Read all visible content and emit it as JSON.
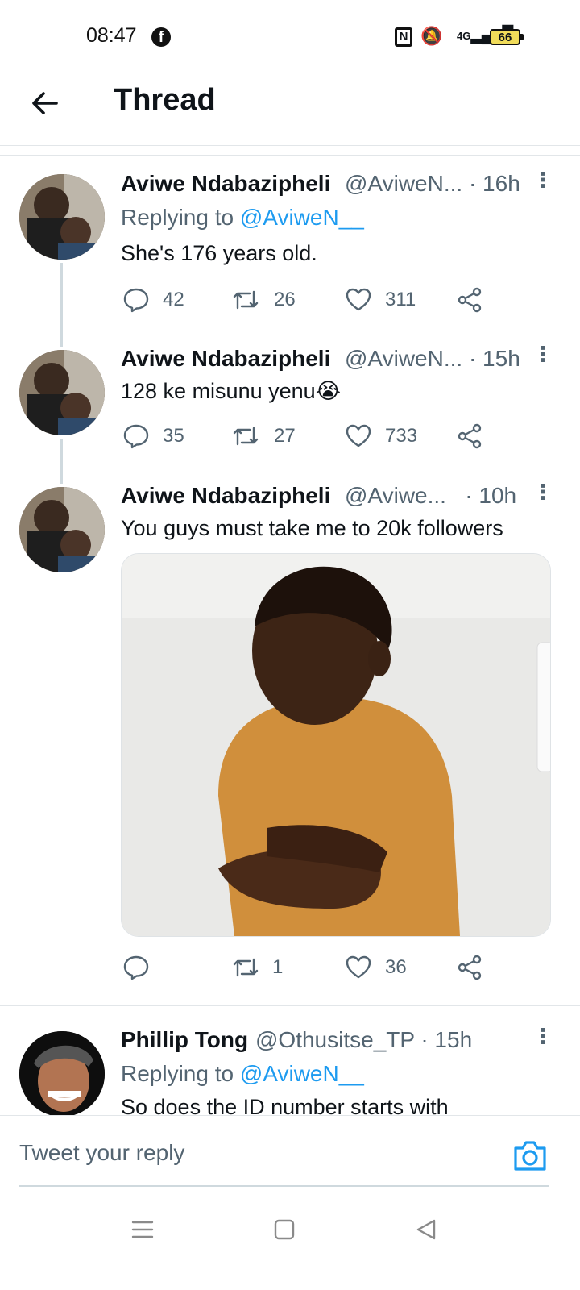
{
  "status_bar": {
    "time": "08:47",
    "network": "4G",
    "battery": "66"
  },
  "header": {
    "title": "Thread"
  },
  "tweets": [
    {
      "name": "Aviwe Ndabazipheli",
      "handle": "@AviweN...",
      "time": "· 16h",
      "replying_prefix": "Replying to",
      "replying_to": "@AviweN__",
      "text": "She's 176 years old.",
      "replies": "42",
      "retweets": "26",
      "likes": "311"
    },
    {
      "name": "Aviwe Ndabazipheli",
      "handle": "@AviweN...",
      "time": "· 15h",
      "text": "128 ke misunu yenu😭",
      "replies": "35",
      "retweets": "27",
      "likes": "733"
    },
    {
      "name": "Aviwe Ndabazipheli",
      "handle": "@Aviwe...",
      "time": "· 10h",
      "text": "You guys must take me to 20k followers",
      "replies": "",
      "retweets": "1",
      "likes": "36"
    },
    {
      "name": "Phillip Tong",
      "handle": "@Othusitse_TP",
      "time": "· 15h",
      "replying_prefix": "Replying to",
      "replying_to": "@AviweN__",
      "text": "So does the ID number starts with"
    }
  ],
  "reply_bar": {
    "placeholder": "Tweet your reply"
  },
  "colors": {
    "link": "#1d9bf0",
    "muted": "#536471",
    "text": "#0f1419"
  }
}
